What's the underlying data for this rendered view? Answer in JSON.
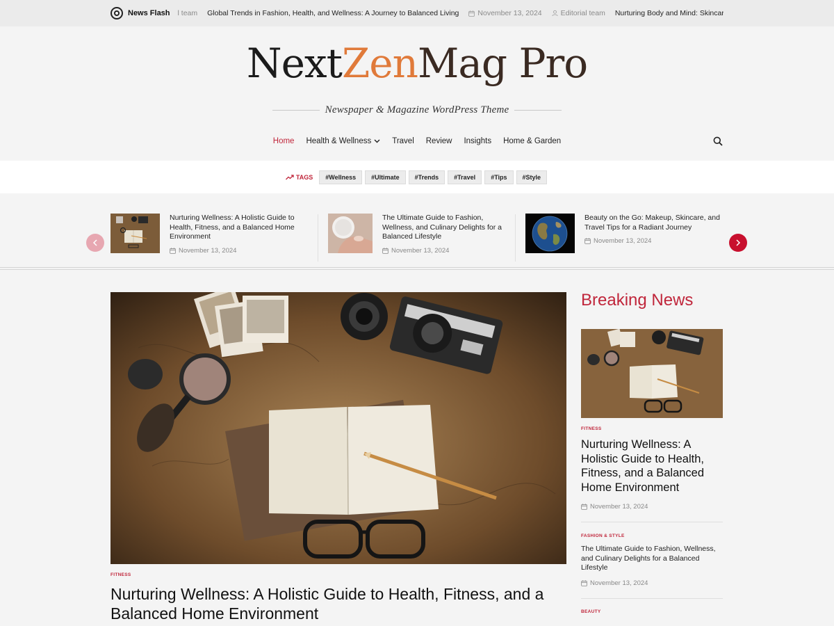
{
  "ticker": {
    "label": "News Flash",
    "prev_author": "l team",
    "items": [
      {
        "title": "Global Trends in Fashion, Health, and Wellness: A Journey to Balanced Living",
        "date": "November 13, 2024",
        "author": "Editorial team"
      },
      {
        "title": "Nurturing Body and Mind: Skincare, Culinary"
      }
    ]
  },
  "header": {
    "logo_part1": "Next",
    "logo_part2": "Zen",
    "logo_part3": "Mag Pro",
    "tagline": "Newspaper & Magazine WordPress Theme"
  },
  "nav": {
    "items": [
      "Home",
      "Health & Wellness",
      "Travel",
      "Review",
      "Insights",
      "Home & Garden"
    ],
    "active": "Home"
  },
  "tags": {
    "label": "TAGS",
    "items": [
      "#Wellness",
      "#Ultimate",
      "#Trends",
      "#Travel",
      "#Tips",
      "#Style"
    ]
  },
  "carousel": {
    "items": [
      {
        "title": "Nurturing Wellness: A Holistic Guide to Health, Fitness, and a Balanced Home Environment",
        "date": "November 13, 2024"
      },
      {
        "title": "The Ultimate Guide to Fashion, Wellness, and Culinary Delights for a Balanced Lifestyle",
        "date": "November 13, 2024"
      },
      {
        "title": "Beauty on the Go: Makeup, Skincare, and Travel Tips for a Radiant Journey",
        "date": "November 13, 2024"
      }
    ]
  },
  "feature": {
    "category": "FITNESS",
    "title": "Nurturing Wellness: A Holistic Guide to Health, Fitness, and a Balanced Home Environment"
  },
  "sidebar": {
    "heading": "Breaking News",
    "posts": [
      {
        "category": "FITNESS",
        "title": "Nurturing Wellness: A Holistic Guide to Health, Fitness, and a Balanced Home Environment",
        "date": "November 13, 2024"
      },
      {
        "category": "FASHION & STYLE",
        "title": "The Ultimate Guide to Fashion, Wellness, and Culinary Delights for a Balanced Lifestyle",
        "date": "November 13, 2024"
      },
      {
        "category": "BEAUTY"
      }
    ]
  },
  "colors": {
    "accent": "#c0263b",
    "background": "#f4f4f4"
  }
}
